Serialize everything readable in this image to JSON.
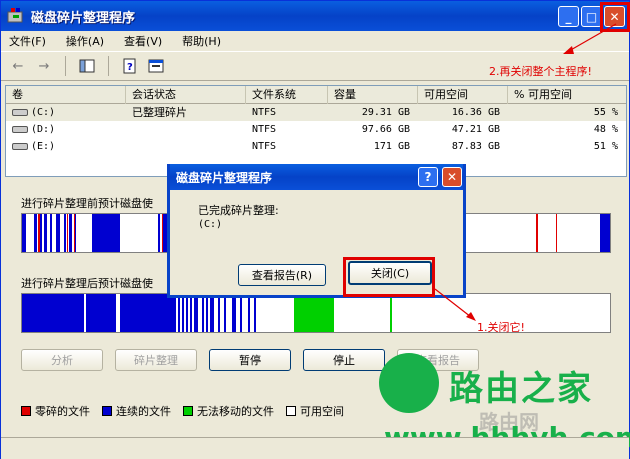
{
  "window": {
    "title": "磁盘碎片整理程序"
  },
  "menu": [
    "文件(F)",
    "操作(A)",
    "查看(V)",
    "帮助(H)"
  ],
  "annotations": {
    "close_app": "2.再关闭整个主程序!",
    "close_dialog": "1.关闭它!"
  },
  "volumes": {
    "headers": [
      "卷",
      "会话状态",
      "文件系统",
      "容量",
      "可用空间",
      "% 可用空间"
    ],
    "rows": [
      {
        "vol": "(C:)",
        "status": "已整理碎片",
        "fs": "NTFS",
        "cap": "29.31 GB",
        "free": "16.36 GB",
        "pct": "55 %"
      },
      {
        "vol": "(D:)",
        "status": "",
        "fs": "NTFS",
        "cap": "97.66 GB",
        "free": "47.21 GB",
        "pct": "48 %"
      },
      {
        "vol": "(E:)",
        "status": "",
        "fs": "NTFS",
        "cap": "171 GB",
        "free": "87.83 GB",
        "pct": "51 %"
      }
    ]
  },
  "sections": {
    "before": "进行碎片整理前预计磁盘使",
    "after": "进行碎片整理后预计磁盘使"
  },
  "buttons": {
    "analyze": "分析",
    "defrag": "碎片整理",
    "pause": "暂停",
    "stop": "停止",
    "report": "查看报告"
  },
  "legend": [
    {
      "label": "零碎的文件",
      "color": "#e00000"
    },
    {
      "label": "连续的文件",
      "color": "#0000d0"
    },
    {
      "label": "无法移动的文件",
      "color": "#00d000"
    },
    {
      "label": "可用空间",
      "color": "#ffffff"
    }
  ],
  "dialog": {
    "title": "磁盘碎片整理程序",
    "line1": "已完成碎片整理:",
    "line2": "(C:)",
    "report_label": "查看报告(R)",
    "close_label": "关闭(C)"
  },
  "watermark": {
    "brand": "路由之家",
    "url": "www.hhhyh.com",
    "sub": "路由网"
  },
  "colors": {
    "fragmented": "#e00000",
    "contiguous": "#0000d0",
    "unmovable": "#00d000",
    "free": "#ffffff"
  }
}
